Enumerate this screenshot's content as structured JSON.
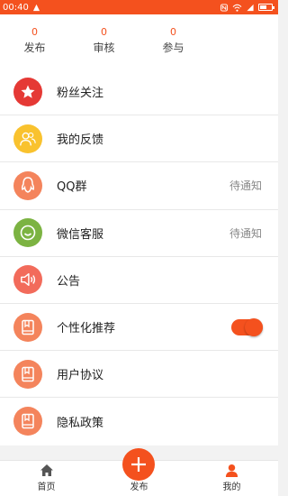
{
  "status_bar": {
    "time": "00:40",
    "icons": [
      "notification-icon",
      "wifi-icon",
      "sim-icon",
      "nfc-icon",
      "signal-icon",
      "battery-icon"
    ],
    "battery_level": 0.6
  },
  "stats": [
    {
      "value": "0",
      "label": "发布"
    },
    {
      "value": "0",
      "label": "审核"
    },
    {
      "value": "0",
      "label": "参与"
    }
  ],
  "menu": [
    {
      "label": "粉丝关注",
      "icon": "star-icon",
      "color": "#e53935"
    },
    {
      "label": "我的反馈",
      "icon": "people-icon",
      "color": "#f9c22e"
    },
    {
      "label": "QQ群",
      "icon": "qq-icon",
      "color": "#f4845c",
      "status": "待通知"
    },
    {
      "label": "微信客服",
      "icon": "wechat-icon",
      "color": "#7cb342",
      "status": "待通知"
    },
    {
      "label": "公告",
      "icon": "speaker-icon",
      "color": "#f26b5b"
    },
    {
      "label": "个性化推荐",
      "icon": "book-icon",
      "color": "#f4845c",
      "toggle_on": true
    },
    {
      "label": "用户协议",
      "icon": "book-icon",
      "color": "#f4845c"
    },
    {
      "label": "隐私政策",
      "icon": "book-icon",
      "color": "#f4845c"
    }
  ],
  "tabbar": {
    "home_label": "首页",
    "publish_label": "发布",
    "mine_label": "我的"
  },
  "colors": {
    "accent": "#f4511e",
    "background": "#f2f2f2"
  }
}
